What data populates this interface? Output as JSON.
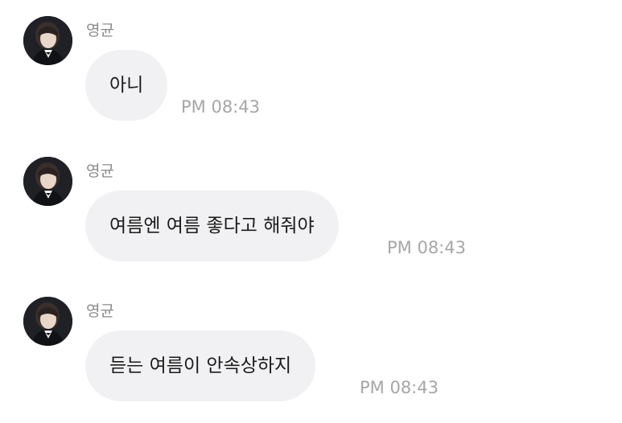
{
  "messages": [
    {
      "sender": "영균",
      "text": "아니",
      "time": "PM 08:43"
    },
    {
      "sender": "영균",
      "text": "여름엔 여름 좋다고 해줘야",
      "time": "PM 08:43"
    },
    {
      "sender": "영균",
      "text": "듣는 여름이 안속상하지",
      "time": "PM 08:43"
    }
  ]
}
